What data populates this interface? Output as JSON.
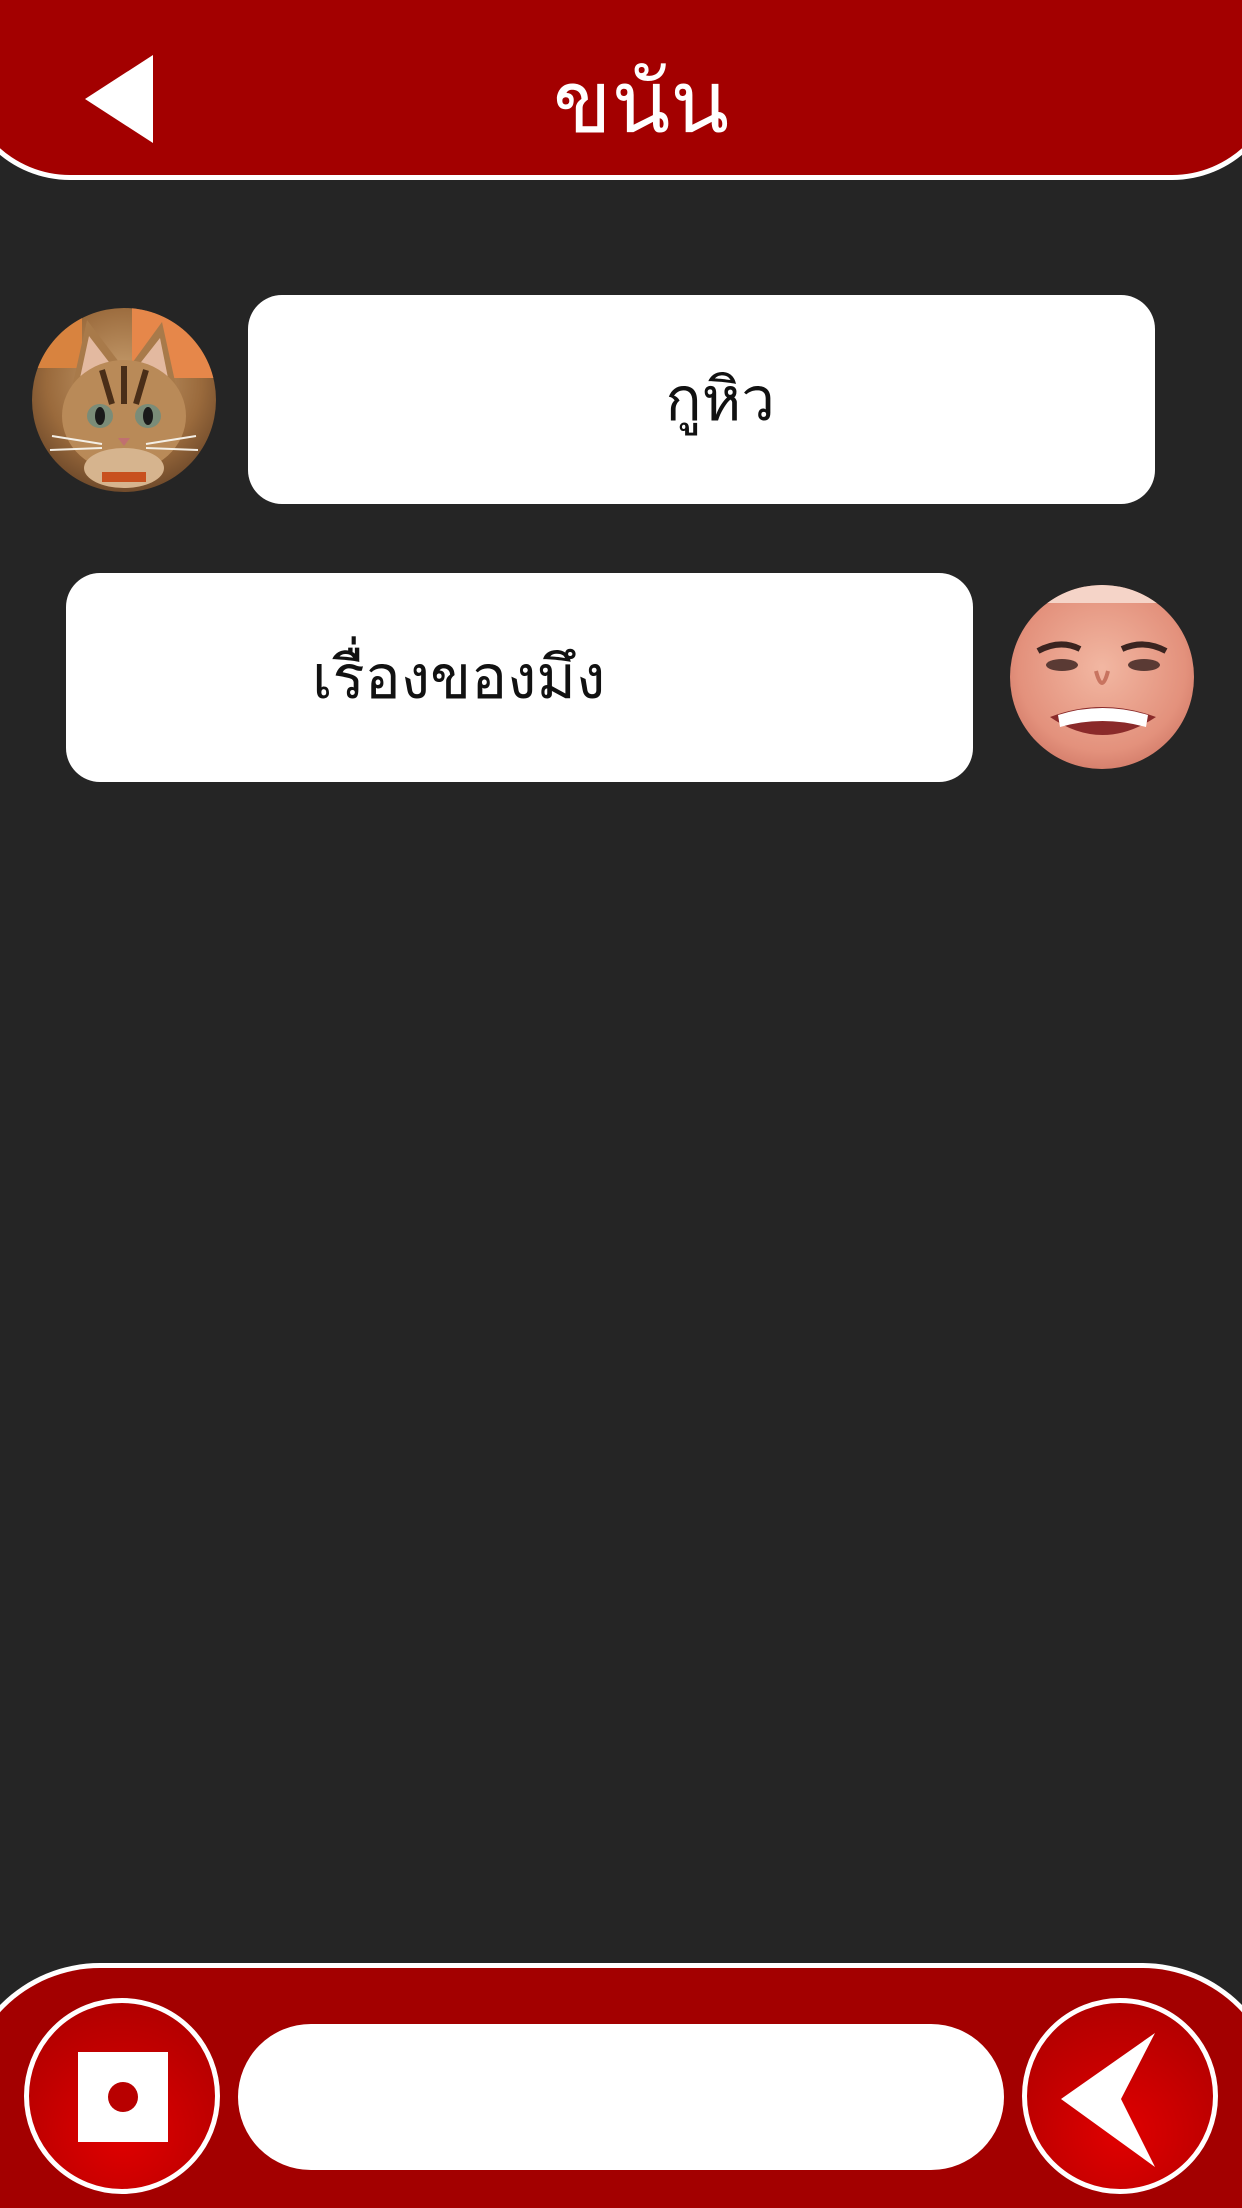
{
  "header": {
    "title": "ขนัน",
    "back_icon": "back-arrow-icon"
  },
  "messages": [
    {
      "sender": "other",
      "text": "กูหิว",
      "avatar": "cat-avatar"
    },
    {
      "sender": "self",
      "text": "เรื่องของมึง",
      "avatar": "user-face-avatar"
    }
  ],
  "composer": {
    "input_value": "",
    "input_placeholder": "",
    "stop_icon": "stop-record-icon",
    "send_icon": "send-arrow-icon"
  },
  "colors": {
    "accent": "#a30000",
    "background": "#252525",
    "bubble": "#ffffff"
  }
}
